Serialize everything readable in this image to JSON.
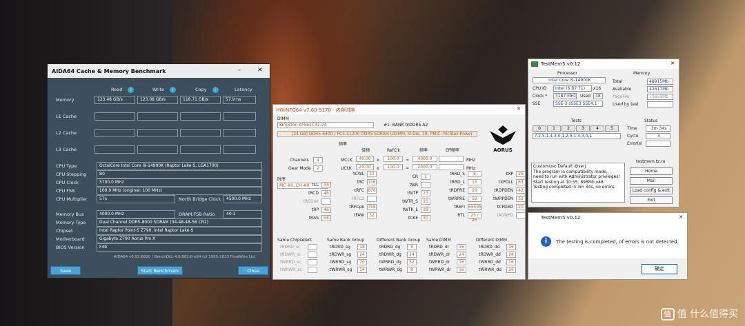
{
  "aida": {
    "title": "AIDA64 Cache & Memory Benchmark",
    "cols": [
      "Read",
      "Write",
      "Copy",
      "Latency"
    ],
    "rows": [
      {
        "label": "Memory",
        "read": "123.48 GB/s",
        "write": "123.08 GB/s",
        "copy": "118.71 GB/s",
        "latency": "57.9 ns"
      },
      {
        "label": "L1 Cache"
      },
      {
        "label": "L2 Cache"
      },
      {
        "label": "L3 Cache"
      }
    ],
    "info": [
      {
        "label": "CPU Type",
        "value": "OctalCore Intel Core i9-14900K (Raptor Lake-S, LGA1700)"
      },
      {
        "label": "CPU Stepping",
        "value": "B0"
      },
      {
        "label": "CPU Clock",
        "value": "5700.0 MHz"
      },
      {
        "label": "CPU FSB",
        "value": "100.0 MHz (original: 100 MHz)"
      },
      {
        "label": "CPU Multiplier",
        "value": "57x"
      }
    ],
    "nb_label": "North Bridge Clock",
    "nb_value": "4500.0 MHz",
    "info2": [
      {
        "label": "Memory Bus",
        "value": "4000.0 MHz"
      },
      {
        "label": "Memory Type",
        "value": "Dual Channel DDR5-8000 SDRAM (34-48-48-58 CR2)"
      },
      {
        "label": "Chipset",
        "value": "Intel Raptor Point-S Z790, Intel Raptor Lake-S"
      },
      {
        "label": "Motherboard",
        "value": "Gigabyte Z790 Aorus Pro X"
      },
      {
        "label": "BIOS Version",
        "value": "F4b"
      }
    ],
    "ratio_label": "DRAM:FSB Ratio",
    "ratio_value": "40:1",
    "footer": "AIDA64 v6.92.6600 / BenchDLL 4.6.882.8-x64  (c) 1995-2023 FinalWire Ltd.",
    "save": "Save",
    "start": "Start Benchmark",
    "close": "Close"
  },
  "hw": {
    "title": "HWiNFO64 v7.60-5170 - 内存时序",
    "dimm_label": "DIMM",
    "dimm_select": "Kingston KF564C32-24",
    "bank": "#1: BANK 0/DDR5-A2",
    "module": "[24 GB] DDR5-6400 / PC5-51200 DDR5 SDRAM UDIMM, M-Die, 1R, PMIC: Richtek Power",
    "freq_hdr": "频率",
    "hdr_mult": "倍频",
    "hdr_ref": "RefClk",
    "hdr_freq": "频率",
    "hdr_eff": "Eff频率",
    "channels_label": "Channels",
    "channels": "4",
    "gear_label": "Gear Mode",
    "gear": "2",
    "mclk_label": "MCLK",
    "mclk_mult": "40.00",
    "mclk_ref": "100.0",
    "mclk_freq": "4000.0",
    "mhz": "MHz",
    "uclk_label": "UCLK",
    "uclk_mult": "20.00",
    "uclk_ref": "100.0",
    "uclk_freq": "2000.0",
    "timing_hdr": "时序",
    "mc_select": "MC #0, CH #0",
    "t_col1": [
      [
        "tCL",
        "34"
      ],
      [
        "tRCD",
        "48"
      ],
      [
        "tRCDwr",
        ""
      ],
      [
        "tRP",
        "48"
      ],
      [
        "tRAS",
        "58"
      ]
    ],
    "t_col2": [
      [
        "tCWL",
        "32"
      ],
      [
        "tRC",
        "106"
      ],
      [
        "tRFC",
        "878"
      ],
      [
        "tRFC2",
        ""
      ],
      [
        "tRFCpb",
        "758"
      ],
      [
        "tFAW",
        "32"
      ]
    ],
    "t_col3": [
      [
        "CR",
        "2"
      ],
      [
        "tWR",
        "-"
      ],
      [
        "tWTP",
        "23"
      ],
      [
        "tWTR_S",
        "10"
      ],
      [
        "tWTR_L",
        "28"
      ],
      [
        "tCKE",
        "30"
      ]
    ],
    "t_col4": [
      [
        "tRRD_S",
        "8"
      ],
      [
        "tRRD_L",
        "15"
      ],
      [
        "tRDPRE",
        "29"
      ],
      [
        "tWRPRE",
        "52"
      ],
      [
        "tREFI",
        "65535"
      ],
      [
        "RTL",
        "25 / 25"
      ]
    ],
    "t_col5": [
      [
        "tXP",
        "26"
      ],
      [
        "tXPDLL",
        "63"
      ],
      [
        "tRDPDEN",
        "42"
      ],
      [
        "tWRPDEN",
        "52"
      ],
      [
        "tCPDED",
        "20"
      ],
      [
        "tAONPD",
        ""
      ]
    ],
    "groups": [
      {
        "title": "Same Chipselect",
        "rows": [
          [
            "tRDRD_sc",
            ""
          ],
          [
            "tRDWR_sc",
            ""
          ],
          [
            "tWRRD_sc",
            ""
          ],
          [
            "tWRWR_sc",
            ""
          ]
        ]
      },
      {
        "title": "Same Bank Group",
        "rows": [
          [
            "tRDRD_sg",
            "18"
          ],
          [
            "tRDWR_sg",
            "24"
          ],
          [
            "tWRRD_sg",
            "70"
          ],
          [
            "tWRWR_sg",
            "14"
          ]
        ]
      },
      {
        "title": "Different Bank Group",
        "rows": [
          [
            "tRDRD_dg",
            "8"
          ],
          [
            "tRDWR_dg",
            "24"
          ],
          [
            "tWRRD_dg",
            "52"
          ],
          [
            "tWRWR_dg",
            "8"
          ]
        ]
      },
      {
        "title": "Same DIMM",
        "rows": [
          [
            "tRDRD_dr",
            "16"
          ],
          [
            "tRDWR_dr",
            "24"
          ],
          [
            "tWRRD_dr",
            "16"
          ],
          [
            "tWRWR_dr",
            "16"
          ]
        ]
      },
      {
        "title": "Different DIMM",
        "rows": [
          [
            "tRDRD_dd",
            "16"
          ],
          [
            "tRDWR_dd",
            "24"
          ],
          [
            "tWRRD_dd",
            "16"
          ],
          [
            "tWRWR_dd",
            "16"
          ]
        ]
      }
    ]
  },
  "tm": {
    "title": "TestMem5 v0.12",
    "processor_hdr": "Processor",
    "cpu_name": "Intel Core i9-14900K",
    "cpuid_label": "CPU ID",
    "cpuid": "Intel (6 B7 71)",
    "x16": "x16",
    "clock_label": "Clock *",
    "clock": "3187 MHz",
    "used_label": "Used",
    "used": "48",
    "sse_label": "SSE",
    "sse": "SSE-3 sSSE3 SSE4.1",
    "memory_hdr": "Memory",
    "total_label": "Total",
    "total": "48915Mb",
    "avail_label": "Available",
    "avail": "42617Mb",
    "pagefile_label": "PageFile",
    "pagefile": "10659Mb",
    "usedby_label": "Used by test",
    "usedby": "",
    "tests_hdr": "Tests",
    "tests": [
      "0",
      "1",
      "2",
      "3",
      "4",
      "5"
    ],
    "sequence": "?,2,5,1,4,3,0,1,2,5,1,4,3,0,1",
    "status_hdr": "Status",
    "time_label": "Time",
    "time": "3m 34s",
    "cycle_label": "Cycle",
    "cycle": "3",
    "errors_label": "Error(s)",
    "errors": "",
    "log": "Customize: Default @serj\nThe program in compatibility mode,\nneed to run with Administrator privileges!\nStart testing at 10:55, 896Mb x48\nTesting completed in 3m 34s, no errors.",
    "site": "testmem.tz.ru",
    "btn_home": "Home",
    "btn_mail": "Mail",
    "btn_load": "Load config & exit",
    "btn_exit": "Exit"
  },
  "dlg": {
    "title": "TestMem5 v0.12",
    "message": "The testing is completed, of errors is not detected.",
    "ok": "确定"
  },
  "watermark": "值 什么值得买"
}
